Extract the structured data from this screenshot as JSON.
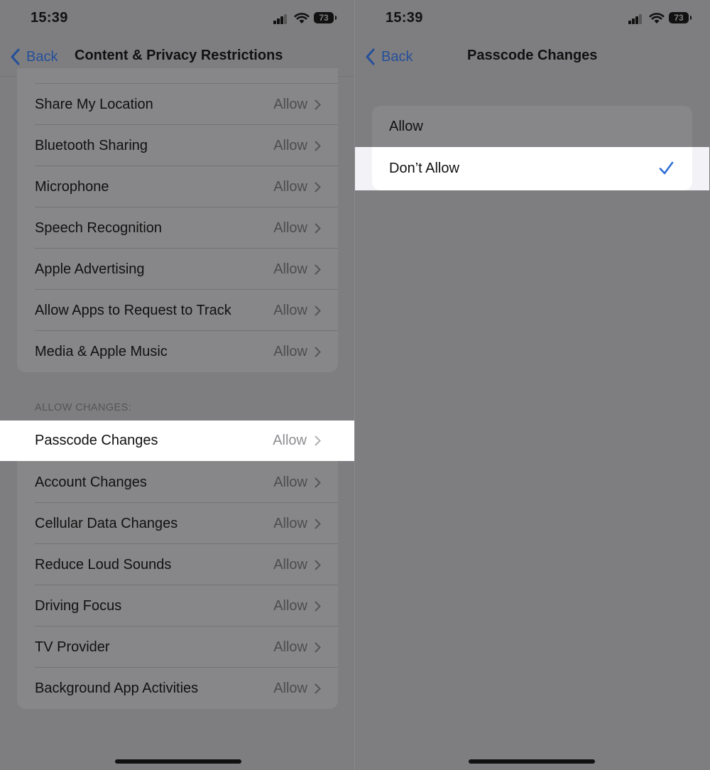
{
  "left": {
    "status": {
      "time": "15:39",
      "battery": "73"
    },
    "nav": {
      "back_label": "Back",
      "title": "Content & Privacy Restrictions"
    },
    "privacy_items": [
      {
        "label": "Share My Location",
        "value": "Allow"
      },
      {
        "label": "Bluetooth Sharing",
        "value": "Allow"
      },
      {
        "label": "Microphone",
        "value": "Allow"
      },
      {
        "label": "Speech Recognition",
        "value": "Allow"
      },
      {
        "label": "Apple Advertising",
        "value": "Allow"
      },
      {
        "label": "Allow Apps to Request to Track",
        "value": "Allow"
      },
      {
        "label": "Media & Apple Music",
        "value": "Allow"
      }
    ],
    "section_header": "ALLOW CHANGES:",
    "highlighted_item": {
      "label": "Passcode Changes",
      "value": "Allow"
    },
    "changes_items": [
      {
        "label": "Account Changes",
        "value": "Allow"
      },
      {
        "label": "Cellular Data Changes",
        "value": "Allow"
      },
      {
        "label": "Reduce Loud Sounds",
        "value": "Allow"
      },
      {
        "label": "Driving Focus",
        "value": "Allow"
      },
      {
        "label": "TV Provider",
        "value": "Allow"
      },
      {
        "label": "Background App Activities",
        "value": "Allow"
      }
    ]
  },
  "right": {
    "status": {
      "time": "15:39",
      "battery": "73"
    },
    "nav": {
      "back_label": "Back",
      "title": "Passcode Changes"
    },
    "options": [
      {
        "label": "Allow",
        "selected": false
      },
      {
        "label": "Don’t Allow",
        "selected": true
      }
    ]
  },
  "colors": {
    "accent": "#2f6fd6",
    "dim_overlay": "#7e7e80"
  }
}
